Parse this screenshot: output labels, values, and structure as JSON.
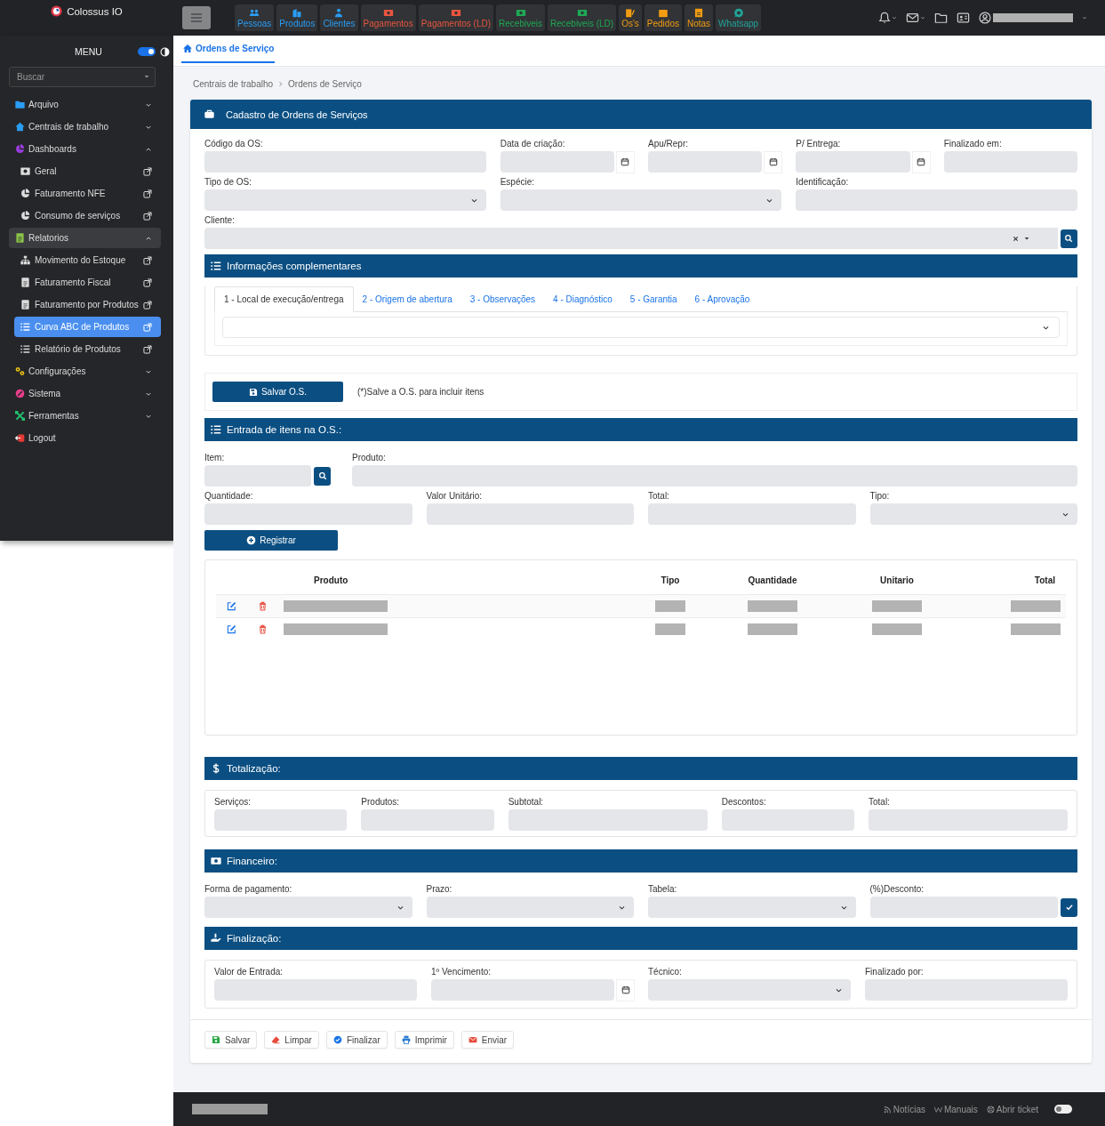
{
  "brand": {
    "name": "Colossus IO"
  },
  "shortcuts": [
    {
      "label": "Pessoas",
      "color": "#2a9df4"
    },
    {
      "label": "Produtos",
      "color": "#2a9df4"
    },
    {
      "label": "Clientes",
      "color": "#2a9df4"
    },
    {
      "label": "Pagamentos",
      "color": "#e8553f"
    },
    {
      "label": "Pagamentos (LD)",
      "color": "#e8553f"
    },
    {
      "label": "Recebiveis",
      "color": "#1fa855"
    },
    {
      "label": "Recebiveis (LD)",
      "color": "#1fa855"
    },
    {
      "label": "Os's",
      "color": "#f39c12"
    },
    {
      "label": "Pedidos",
      "color": "#f39c12"
    },
    {
      "label": "Notas",
      "color": "#f39c12"
    },
    {
      "label": "Whatsapp",
      "color": "#20a59a"
    }
  ],
  "sidebar": {
    "title": "MENU",
    "dark_mode": {
      "on": true
    },
    "search": {
      "placeholder": "Buscar"
    },
    "items": [
      {
        "label": "Arquivo",
        "kind": "group",
        "color": "#2a9df4",
        "expanded": false,
        "selected": false
      },
      {
        "label": "Centrais de trabalho",
        "kind": "group",
        "color": "#2a9df4",
        "expanded": false,
        "selected": false
      },
      {
        "label": "Dashboards",
        "kind": "group",
        "color": "#9b3de0",
        "expanded": true,
        "selected": false,
        "children": [
          {
            "label": "Geral",
            "kind": "page",
            "selected": false
          },
          {
            "label": "Faturamento NFE",
            "kind": "page",
            "selected": false
          },
          {
            "label": "Consumo de serviços",
            "kind": "page",
            "selected": false
          }
        ]
      },
      {
        "label": "Relatorios",
        "kind": "group",
        "color": "#8bc34a",
        "expanded": true,
        "selected": true,
        "children": [
          {
            "label": "Movimento do Estoque",
            "kind": "page",
            "selected": false
          },
          {
            "label": "Faturamento Fiscal",
            "kind": "page",
            "selected": false
          },
          {
            "label": "Faturamento por Produtos",
            "kind": "page",
            "selected": false
          },
          {
            "label": "Curva ABC de Produtos",
            "kind": "page",
            "selected": true
          },
          {
            "label": "Relatório de Produtos",
            "kind": "page",
            "selected": false
          }
        ]
      },
      {
        "label": "Configurações",
        "kind": "group",
        "color": "#f1c40f",
        "expanded": false,
        "selected": false
      },
      {
        "label": "Sistema",
        "kind": "group",
        "color": "#e83e8c",
        "expanded": false,
        "selected": false
      },
      {
        "label": "Ferramentas",
        "kind": "group",
        "color": "#20c070",
        "expanded": false,
        "selected": false
      },
      {
        "label": "Logout",
        "kind": "action",
        "color": "#e53935",
        "selected": false
      }
    ]
  },
  "page_tab": {
    "label": "Ordens de Serviço",
    "selected": true
  },
  "breadcrumb": [
    "Centrais de trabalho",
    "Ordens de Serviço"
  ],
  "form": {
    "title": "Cadastro de Ordens de Serviços",
    "fields": [
      {
        "label": "Código da OS:",
        "kind": "text"
      },
      {
        "label": "Data de criação:",
        "kind": "date"
      },
      {
        "label": "Apu/Repr:",
        "kind": "date"
      },
      {
        "label": "P/ Entrega:",
        "kind": "date"
      },
      {
        "label": "Finalizado em:",
        "kind": "text"
      },
      {
        "label": "Tipo de OS:",
        "kind": "select"
      },
      {
        "label": "Espécie:",
        "kind": "select"
      },
      {
        "label": "Identificação:",
        "kind": "text"
      },
      {
        "label": "Cliente:",
        "kind": "client"
      }
    ]
  },
  "info": {
    "title": "Informações complementares",
    "tabs": [
      {
        "label": "1 - Local de execução/entrega",
        "selected": true
      },
      {
        "label": "2 - Origem de abertura",
        "selected": false
      },
      {
        "label": "3 - Observações",
        "selected": false
      },
      {
        "label": "4 - Diagnóstico",
        "selected": false
      },
      {
        "label": "5 - Garantia",
        "selected": false
      },
      {
        "label": "6 - Aprovação",
        "selected": false
      }
    ]
  },
  "save": {
    "button": "Salvar O.S.",
    "note": "(*)Salve a O.S. para incluir itens"
  },
  "items": {
    "title": "Entrada de itens na O.S.:",
    "fields": [
      {
        "label": "Item:",
        "kind": "lookup"
      },
      {
        "label": "Produto:",
        "kind": "text"
      },
      {
        "label": "Quantidade:",
        "kind": "text"
      },
      {
        "label": "Valor Unitário:",
        "kind": "text"
      },
      {
        "label": "Total:",
        "kind": "text"
      },
      {
        "label": "Tipo:",
        "kind": "select"
      }
    ],
    "register_button": "Registrar",
    "table": {
      "columns": [
        "Produto",
        "Tipo",
        "Quantidade",
        "Unitario",
        "Total"
      ],
      "rows": [
        {
          "masked": true
        },
        {
          "masked": true
        }
      ]
    }
  },
  "totals": {
    "title": "Totalização:",
    "fields": [
      {
        "label": "Serviços:",
        "kind": "text"
      },
      {
        "label": "Produtos:",
        "kind": "text"
      },
      {
        "label": "Subtotal:",
        "kind": "text"
      },
      {
        "label": "Descontos:",
        "kind": "text"
      },
      {
        "label": "Total:",
        "kind": "text"
      }
    ]
  },
  "finance": {
    "title": "Financeiro:",
    "fields": [
      {
        "label": "Forma de pagamento:",
        "kind": "select"
      },
      {
        "label": "Prazo:",
        "kind": "select"
      },
      {
        "label": "Tabela:",
        "kind": "select"
      },
      {
        "label": "(%)Desconto:",
        "kind": "confirm"
      }
    ]
  },
  "closing": {
    "title": "Finalização:",
    "fields": [
      {
        "label": "Valor de Entrada:",
        "kind": "text"
      },
      {
        "label": "1º Vencimento:",
        "kind": "date"
      },
      {
        "label": "Técnico:",
        "kind": "select"
      },
      {
        "label": "Finalizado por:",
        "kind": "text"
      }
    ]
  },
  "actions": [
    {
      "label": "Salvar",
      "color": "#28a745"
    },
    {
      "label": "Limpar",
      "color": "#e74c3c"
    },
    {
      "label": "Finalizar",
      "color": "#1a73e8"
    },
    {
      "label": "Imprimir",
      "color": "#2a7ad0"
    },
    {
      "label": "Enviar",
      "color": "#e74c3c"
    }
  ],
  "footer": {
    "links": [
      "Notícias",
      "Manuais",
      "Abrir ticket"
    ],
    "toggle": {
      "on": false
    }
  }
}
